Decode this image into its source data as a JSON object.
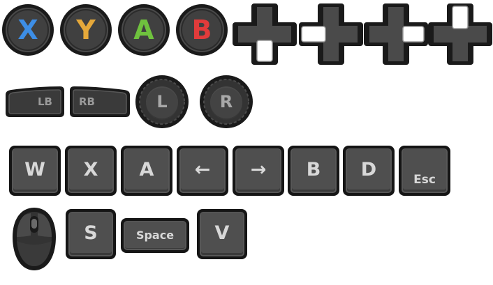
{
  "face_buttons": [
    {
      "label": "X",
      "color": "#3d8ee6"
    },
    {
      "label": "Y",
      "color": "#e5a83a"
    },
    {
      "label": "A",
      "color": "#6fc23e"
    },
    {
      "label": "B",
      "color": "#e23b3b"
    }
  ],
  "dpads": [
    {
      "name": "dpad-down",
      "highlight": "down"
    },
    {
      "name": "dpad-left",
      "highlight": "left"
    },
    {
      "name": "dpad-right",
      "highlight": "right"
    },
    {
      "name": "dpad-up",
      "highlight": "up"
    }
  ],
  "bumpers": {
    "left": "LB",
    "right": "RB"
  },
  "sticks": {
    "left": "L",
    "right": "R"
  },
  "keys_row1": [
    "W",
    "X",
    "A",
    "←",
    "→",
    "B",
    "D",
    "Esc"
  ],
  "keys_row2": {
    "s": "S",
    "space": "Space",
    "v": "V"
  },
  "colors": {
    "dark": "#1a1a1a",
    "key_face": "#4f4f4f",
    "highlight": "#ffffff"
  }
}
